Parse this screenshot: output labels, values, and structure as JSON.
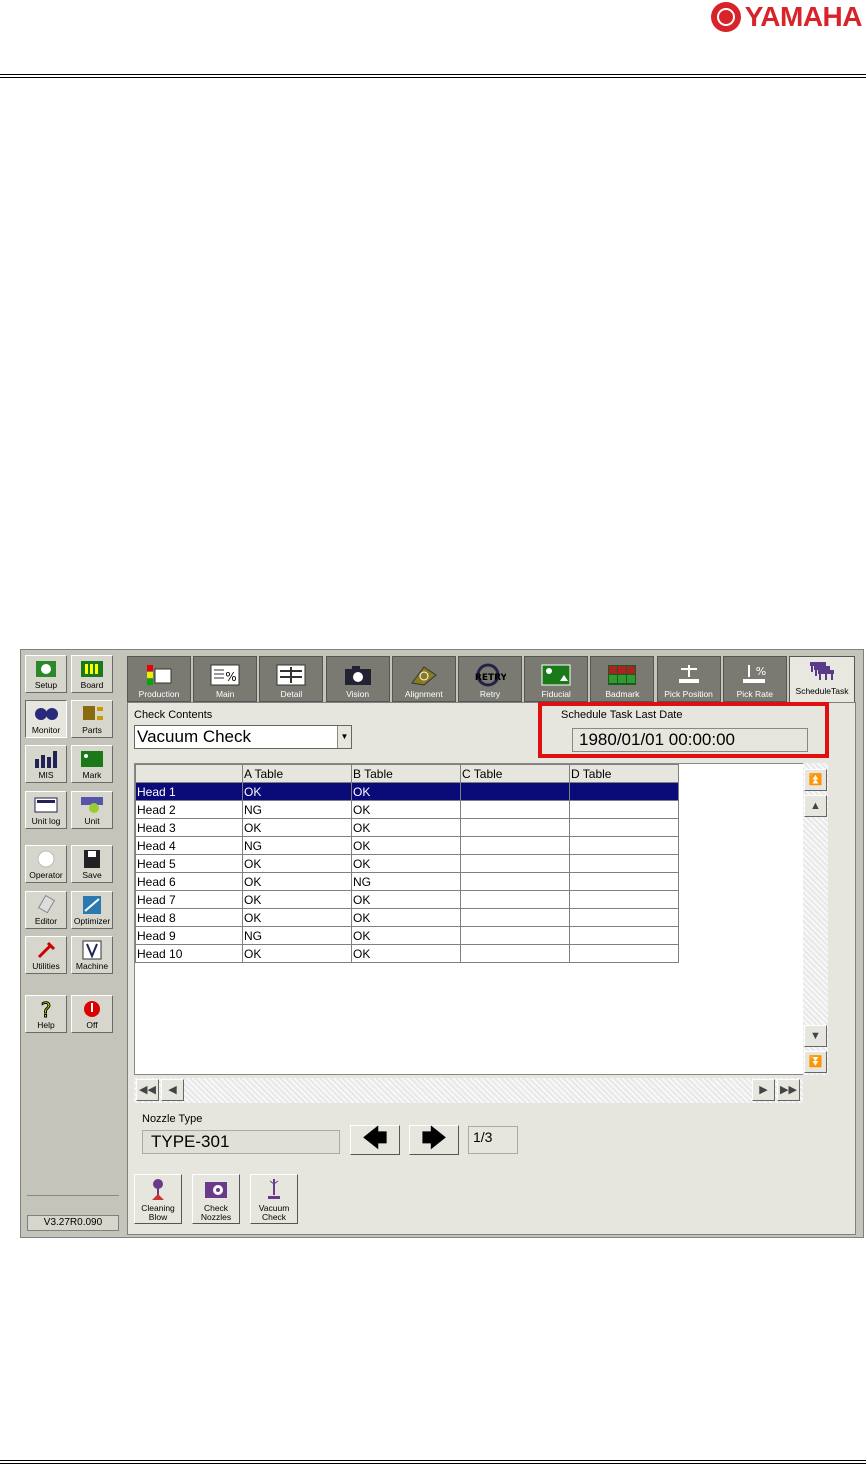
{
  "brand": {
    "name": "YAMAHA",
    "color": "#d8232a"
  },
  "sidebar": {
    "buttons": [
      {
        "label": "Setup",
        "icon": "setup-icon"
      },
      {
        "label": "Board",
        "icon": "board-icon"
      },
      {
        "label": "Monitor",
        "icon": "monitor-icon"
      },
      {
        "label": "Parts",
        "icon": "parts-icon"
      },
      {
        "label": "MIS",
        "icon": "mis-icon"
      },
      {
        "label": "Mark",
        "icon": "mark-icon"
      },
      {
        "label": "Unit log",
        "icon": "unit-log-icon"
      },
      {
        "label": "Unit",
        "icon": "unit-icon"
      },
      {
        "label": "Operator",
        "icon": "operator-icon"
      },
      {
        "label": "Save",
        "icon": "save-icon"
      },
      {
        "label": "Editor",
        "icon": "editor-icon"
      },
      {
        "label": "Optimizer",
        "icon": "optimizer-icon"
      },
      {
        "label": "Utilities",
        "icon": "utilities-icon"
      },
      {
        "label": "Machine",
        "icon": "machine-icon"
      },
      {
        "label": "Help",
        "icon": "help-icon"
      },
      {
        "label": "Off",
        "icon": "power-off-icon"
      }
    ],
    "version": "V3.27R0.090"
  },
  "tabs": [
    {
      "label": "Production"
    },
    {
      "label": "Main"
    },
    {
      "label": "Detail"
    },
    {
      "label": "Vision"
    },
    {
      "label": "Alignment"
    },
    {
      "label": "Retry"
    },
    {
      "label": "Fiducial"
    },
    {
      "label": "Badmark"
    },
    {
      "label": "Pick Position"
    },
    {
      "label": "Pick Rate"
    },
    {
      "label": "ScheduleTask"
    }
  ],
  "check_contents": {
    "label": "Check Contents",
    "value": "Vacuum Check"
  },
  "schedule": {
    "label": "Schedule Task Last Date",
    "value": "1980/01/01 00:00:00"
  },
  "grid": {
    "columns": [
      "",
      "A Table",
      "B Table",
      "C Table",
      "D Table"
    ],
    "rows": [
      [
        "Head 1",
        "OK",
        "OK",
        "",
        ""
      ],
      [
        "Head 2",
        "NG",
        "OK",
        "",
        ""
      ],
      [
        "Head 3",
        "OK",
        "OK",
        "",
        ""
      ],
      [
        "Head 4",
        "NG",
        "OK",
        "",
        ""
      ],
      [
        "Head 5",
        "OK",
        "OK",
        "",
        ""
      ],
      [
        "Head 6",
        "OK",
        "NG",
        "",
        ""
      ],
      [
        "Head 7",
        "OK",
        "OK",
        "",
        ""
      ],
      [
        "Head 8",
        "OK",
        "OK",
        "",
        ""
      ],
      [
        "Head 9",
        "NG",
        "OK",
        "",
        ""
      ],
      [
        "Head 10",
        "OK",
        "OK",
        "",
        ""
      ]
    ]
  },
  "nozzle": {
    "label": "Nozzle Type",
    "value": "TYPE-301",
    "page": "1/3"
  },
  "actions": [
    {
      "label": "Cleaning Blow",
      "icon": "cleaning-blow-icon"
    },
    {
      "label": "Check Nozzles",
      "icon": "check-nozzles-icon"
    },
    {
      "label": "Vacuum Check",
      "icon": "vacuum-check-icon"
    }
  ]
}
